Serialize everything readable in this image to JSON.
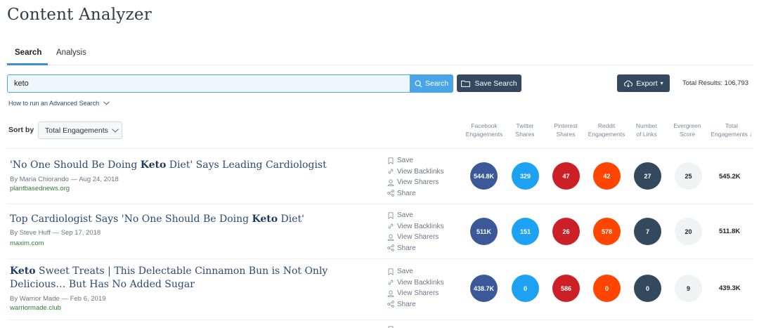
{
  "app": {
    "title": "Content Analyzer"
  },
  "tabs": [
    {
      "label": "Search",
      "active": true
    },
    {
      "label": "Analysis",
      "active": false
    }
  ],
  "search": {
    "value": "keto",
    "search_button": "Search",
    "save_search_button": "Save Search",
    "export_button": "Export",
    "total_results": "Total Results: 106,793"
  },
  "advanced_link": "How to run an Advanced Search",
  "sort": {
    "label": "Sort by",
    "selected": "Total Engagements"
  },
  "columns": [
    {
      "line1": "Facebook",
      "line2": "Engagements"
    },
    {
      "line1": "Twitter",
      "line2": "Shares"
    },
    {
      "line1": "Pinterest",
      "line2": "Shares"
    },
    {
      "line1": "Reddit",
      "line2": "Engagements"
    },
    {
      "line1": "Number",
      "line2": "of Links"
    },
    {
      "line1": "Evergreen",
      "line2": "Score"
    },
    {
      "line1": "Total",
      "line2": "Engagements ↓"
    }
  ],
  "action_labels": {
    "save": "Save",
    "backlinks": "View Backlinks",
    "sharers": "View Sharers",
    "share": "Share"
  },
  "colors": {
    "facebook": "#3b5998",
    "twitter": "#1da1f2",
    "pinterest": "#cb2027",
    "reddit": "#ff4500",
    "links": "#34495e",
    "evergreen": "#f1f2f4",
    "accent": "#4aa5e6"
  },
  "results": [
    {
      "title_pre": "'No One Should Be Doing ",
      "title_bold": "Keto",
      "title_post": " Diet' Says Leading Cardiologist",
      "byline": "By Maria Chiorando — Aug 24, 2018",
      "domain": "plantbasednews.org",
      "facebook": "544.8K",
      "twitter": "329",
      "pinterest": "47",
      "reddit": "42",
      "links": "27",
      "evergreen": "25",
      "total": "545.2K"
    },
    {
      "title_pre": "Top Cardiologist Says 'No One Should Be Doing ",
      "title_bold": "Keto",
      "title_post": " Diet'",
      "byline": "By Steve Huff — Sep 17, 2018",
      "domain": "maxim.com",
      "facebook": "511K",
      "twitter": "151",
      "pinterest": "26",
      "reddit": "578",
      "links": "7",
      "evergreen": "20",
      "total": "511.8K"
    },
    {
      "title_pre": "",
      "title_bold": "Keto",
      "title_post": " Sweet Treats | This Delectable Cinnamon Bun is Not Only Delicious… But Has No Added Sugar",
      "byline": "By Warrior Made — Feb 6, 2019",
      "domain": "warriormade.club",
      "facebook": "438.7K",
      "twitter": "0",
      "pinterest": "586",
      "reddit": "0",
      "links": "0",
      "evergreen": "9",
      "total": "439.3K"
    }
  ]
}
